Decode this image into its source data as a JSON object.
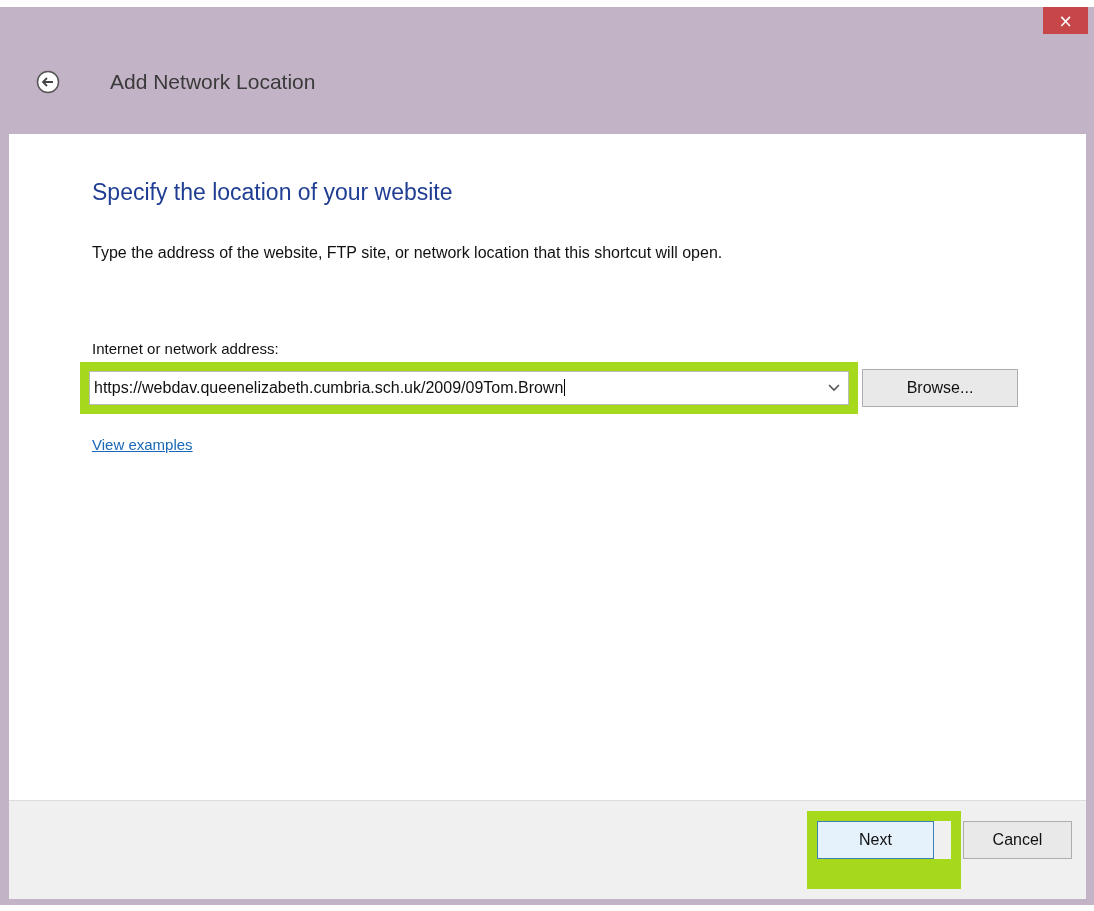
{
  "window": {
    "title": "Add Network Location",
    "close": "×"
  },
  "heading": "Specify the location of your website",
  "description": "Type the address of the website, FTP site, or network location that this shortcut will open.",
  "address": {
    "label": "Internet or network address:",
    "value": "https://webdav.queenelizabeth.cumbria.sch.uk/2009/09Tom.Brown",
    "highlighted": true
  },
  "browse": "Browse...",
  "link": "View examples",
  "buttons": [
    {
      "label": "Next",
      "default": true,
      "highlighted": true
    },
    {
      "label": "Cancel",
      "default": false,
      "highlighted": false
    }
  ]
}
